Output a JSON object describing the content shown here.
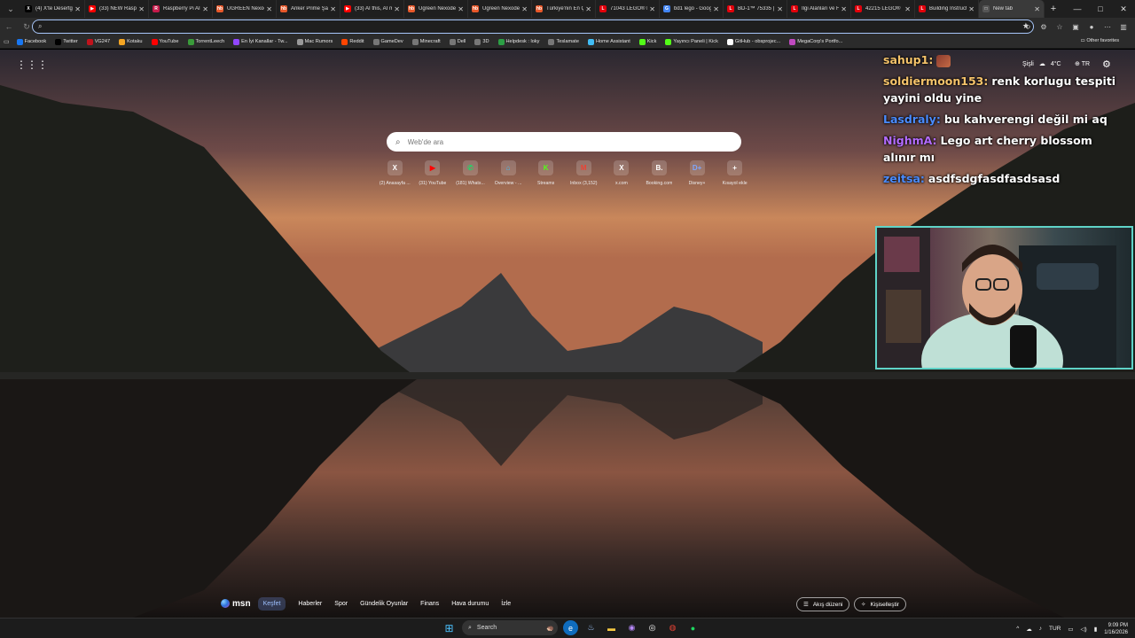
{
  "tabs": [
    {
      "label": "(4) X'te Desertg",
      "icon_color": "#000000",
      "icon": "X"
    },
    {
      "label": "(33) NEW Raspb",
      "icon_color": "#ff0000",
      "icon": "▶"
    },
    {
      "label": "Raspberry Pi AI",
      "icon_color": "#c51a4a",
      "icon": "R"
    },
    {
      "label": "UGREEN Nexode",
      "icon_color": "#e8582a",
      "icon": "hb"
    },
    {
      "label": "Anker Prime Şar",
      "icon_color": "#e8582a",
      "icon": "hb"
    },
    {
      "label": "(33) AI this, AI m",
      "icon_color": "#ff0000",
      "icon": "▶"
    },
    {
      "label": "Ugreen Nexode",
      "icon_color": "#e8582a",
      "icon": "hb"
    },
    {
      "label": "Ugreen Nexode",
      "icon_color": "#e8582a",
      "icon": "hb"
    },
    {
      "label": "Türkiye'nin En Ç",
      "icon_color": "#e8582a",
      "icon": "hb"
    },
    {
      "label": "71043 LEGO® H",
      "icon_color": "#e3000b",
      "icon": "L"
    },
    {
      "label": "bd1 lego - Goog",
      "icon_color": "#4285f4",
      "icon": "G"
    },
    {
      "label": "BD-1™ 75335 |",
      "icon_color": "#e3000b",
      "icon": "L"
    },
    {
      "label": "İlgi Alanları ve H",
      "icon_color": "#e3000b",
      "icon": "L"
    },
    {
      "label": "42215 LEGO® Te",
      "icon_color": "#e3000b",
      "icon": "L"
    },
    {
      "label": "Building Instruct",
      "icon_color": "#e3000b",
      "icon": "L"
    },
    {
      "label": "New tab",
      "icon_color": "#555555",
      "icon": "□",
      "active": true
    }
  ],
  "address": {
    "value": ""
  },
  "bookmarks": [
    {
      "label": "Facebook",
      "color": "#1877f2"
    },
    {
      "label": "Twitter",
      "color": "#000000"
    },
    {
      "label": "VG247",
      "color": "#c0131c"
    },
    {
      "label": "Kotaku",
      "color": "#f5a623"
    },
    {
      "label": "YouTube",
      "color": "#ff0000"
    },
    {
      "label": "TorrentLeech",
      "color": "#3a9b3a"
    },
    {
      "label": "En İyi Kanallar - Tw...",
      "color": "#9146ff"
    },
    {
      "label": "Mac Rumors",
      "color": "#999999"
    },
    {
      "label": "Reddit",
      "color": "#ff4500"
    },
    {
      "label": "GameDev",
      "color": "#777777"
    },
    {
      "label": "Minecraft",
      "color": "#777777"
    },
    {
      "label": "Dell",
      "color": "#777777"
    },
    {
      "label": "3D",
      "color": "#777777"
    },
    {
      "label": "Helpdesk : loky",
      "color": "#2c9f45"
    },
    {
      "label": "Teslamate",
      "color": "#777777"
    },
    {
      "label": "Home Assistant",
      "color": "#41bdf5"
    },
    {
      "label": "Kick",
      "color": "#53fc18"
    },
    {
      "label": "Yayıncı Paneli | Kick",
      "color": "#53fc18"
    },
    {
      "label": "GitHub - obsprojec...",
      "color": "#ffffff"
    },
    {
      "label": "MegaCorp's Portfo...",
      "color": "#c04ac0"
    }
  ],
  "bookmarks_other": "Other favorites",
  "weather": {
    "city": "Şişli",
    "temp": "4°C"
  },
  "lang": "TR",
  "search": {
    "placeholder": "Web'de ara"
  },
  "quicklinks": [
    {
      "label": "(2) Anasayfa ...",
      "icon": "X",
      "color": "#ffffff"
    },
    {
      "label": "(31) YouTube",
      "icon": "▶",
      "color": "#ff0000"
    },
    {
      "label": "(181) Whats...",
      "icon": "✆",
      "color": "#25d366"
    },
    {
      "label": "Overview - ...",
      "icon": "⌂",
      "color": "#41bdf5"
    },
    {
      "label": "Streams",
      "icon": "K",
      "color": "#53fc18"
    },
    {
      "label": "Inbox (3,152)",
      "icon": "M",
      "color": "#ea4335"
    },
    {
      "label": "x.com",
      "icon": "X",
      "color": "#ffffff"
    },
    {
      "label": "Booking.com",
      "icon": "B.",
      "color": "#ffffff"
    },
    {
      "label": "Disney+",
      "icon": "D+",
      "color": "#7ea6ff"
    },
    {
      "label": "Kısayol ekle",
      "icon": "+",
      "color": "#ffffff"
    }
  ],
  "chat": [
    {
      "user": "sahup1:",
      "color": "#f5c36a",
      "text": "",
      "emote": true
    },
    {
      "user": "soldiermoon153:",
      "color": "#f5c36a",
      "text": "renk korlugu tespiti yayini oldu yine"
    },
    {
      "user": "Lasdraly:",
      "color": "#4a8cff",
      "text": "bu kahverengi değil mi aq"
    },
    {
      "user": "NighmA:",
      "color": "#b36bff",
      "text": "Lego art cherry blossom alınır mı"
    },
    {
      "user": "zeitsa:",
      "color": "#4a8cff",
      "text": "asdfsdgfasdfasdsasd"
    }
  ],
  "msn": {
    "logo": "msn",
    "tabs": [
      "Keşfet",
      "Haberler",
      "Spor",
      "Gündelik Oyunlar",
      "Finans",
      "Hava durumu",
      "İzle"
    ],
    "active_tab": "Keşfet",
    "feed_button": "Akış düzeni",
    "customize_button": "Kişiselleştir"
  },
  "taskbar": {
    "search": "Search",
    "tray_lang": "TUR",
    "time": "9:09 PM",
    "date": "1/16/2026"
  }
}
